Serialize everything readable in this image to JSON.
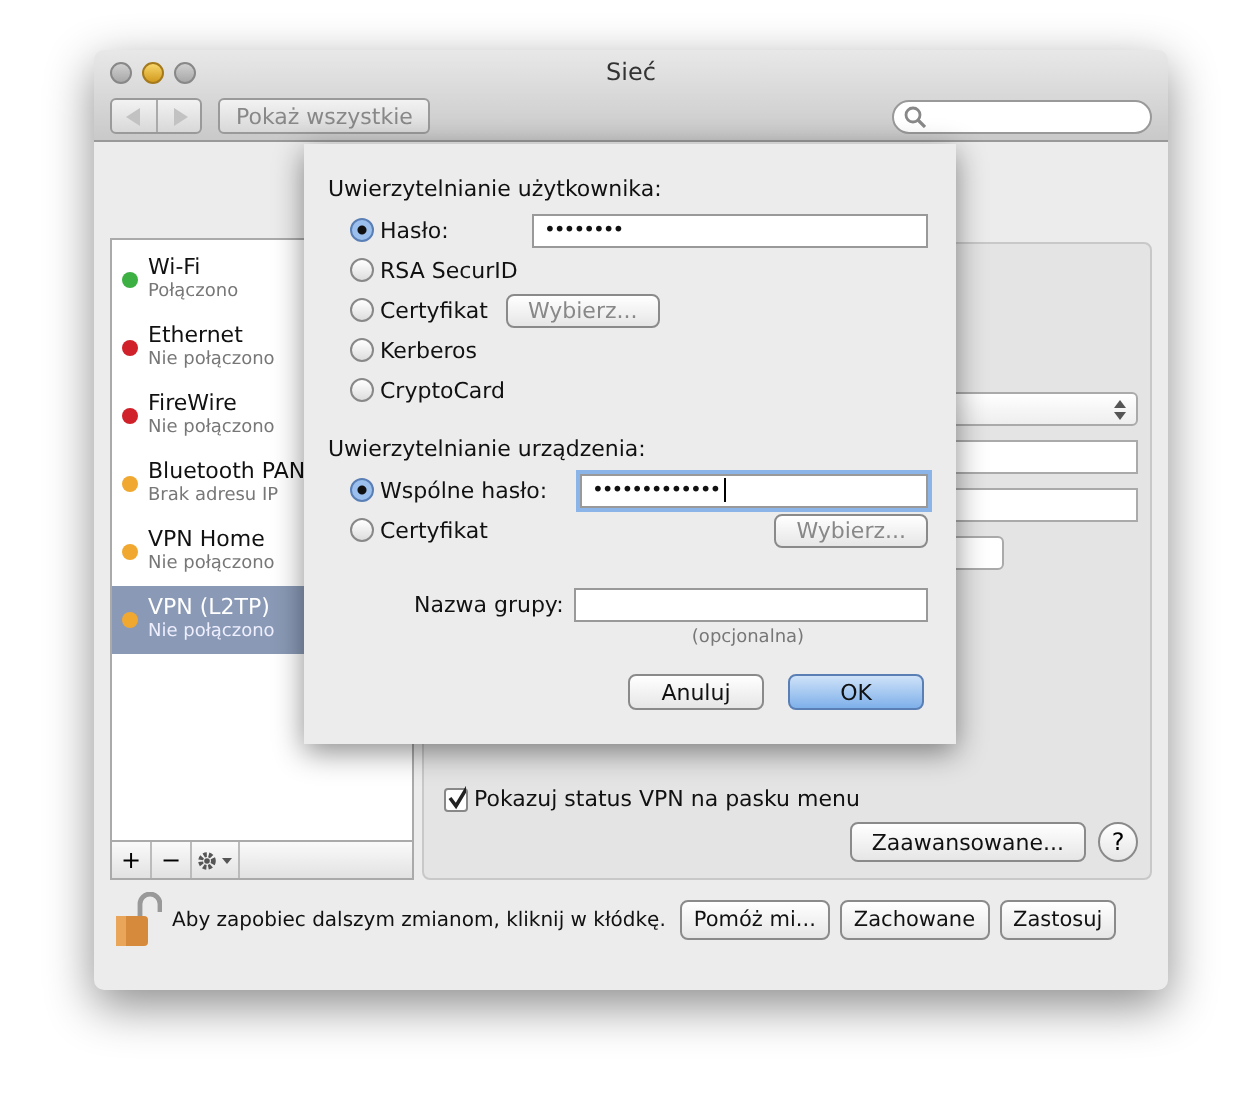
{
  "window": {
    "title": "Sieć"
  },
  "toolbar": {
    "show_all": "Pokaż wszystkie"
  },
  "services": [
    {
      "name": "Wi-Fi",
      "status": "Połączono",
      "color": "#3cb043",
      "selected": false
    },
    {
      "name": "Ethernet",
      "status": "Nie połączono",
      "color": "#d0202a",
      "selected": false
    },
    {
      "name": "FireWire",
      "status": "Nie połączono",
      "color": "#d0202a",
      "selected": false
    },
    {
      "name": "Bluetooth PAN",
      "status": "Brak adresu IP",
      "color": "#f0a830",
      "selected": false
    },
    {
      "name": "VPN Home",
      "status": "Nie połączono",
      "color": "#f0a830",
      "selected": false
    },
    {
      "name": "VPN (L2TP)",
      "status": "Nie połączono",
      "color": "#f0a830",
      "selected": true
    }
  ],
  "list_toolbar": {
    "add": "+",
    "remove": "−"
  },
  "sheet": {
    "user_auth": {
      "heading": "Uwierzytelnianie użytkownika:",
      "options": [
        {
          "label": "Hasło:",
          "selected": true,
          "kind": "field",
          "value": "••••••••"
        },
        {
          "label": "RSA SecurID",
          "selected": false,
          "kind": "plain"
        },
        {
          "label": "Certyfikat",
          "selected": false,
          "kind": "button",
          "button": "Wybierz..."
        },
        {
          "label": "Kerberos",
          "selected": false,
          "kind": "plain"
        },
        {
          "label": "CryptoCard",
          "selected": false,
          "kind": "plain"
        }
      ]
    },
    "device_auth": {
      "heading": "Uwierzytelnianie urządzenia:",
      "options": [
        {
          "label": "Wspólne hasło:",
          "selected": true,
          "kind": "field",
          "value": "•••••••••••••"
        },
        {
          "label": "Certyfikat",
          "selected": false,
          "kind": "button-right",
          "button": "Wybierz..."
        }
      ]
    },
    "group_name": {
      "label": "Nazwa grupy:",
      "hint": "(opcjonalna)"
    },
    "buttons": [
      {
        "label": "Anuluj",
        "default": false
      },
      {
        "label": "OK",
        "default": true
      }
    ]
  },
  "show_status": {
    "label": "Pokazuj status VPN na pasku menu",
    "checked": true
  },
  "advanced_button": "Zaawansowane...",
  "help_button": "?",
  "lock_text": "Aby zapobiec dalszym zmianom, kliknij w kłódkę.",
  "footer_buttons": [
    "Pomóż mi...",
    "Zachowane",
    "Zastosuj"
  ]
}
